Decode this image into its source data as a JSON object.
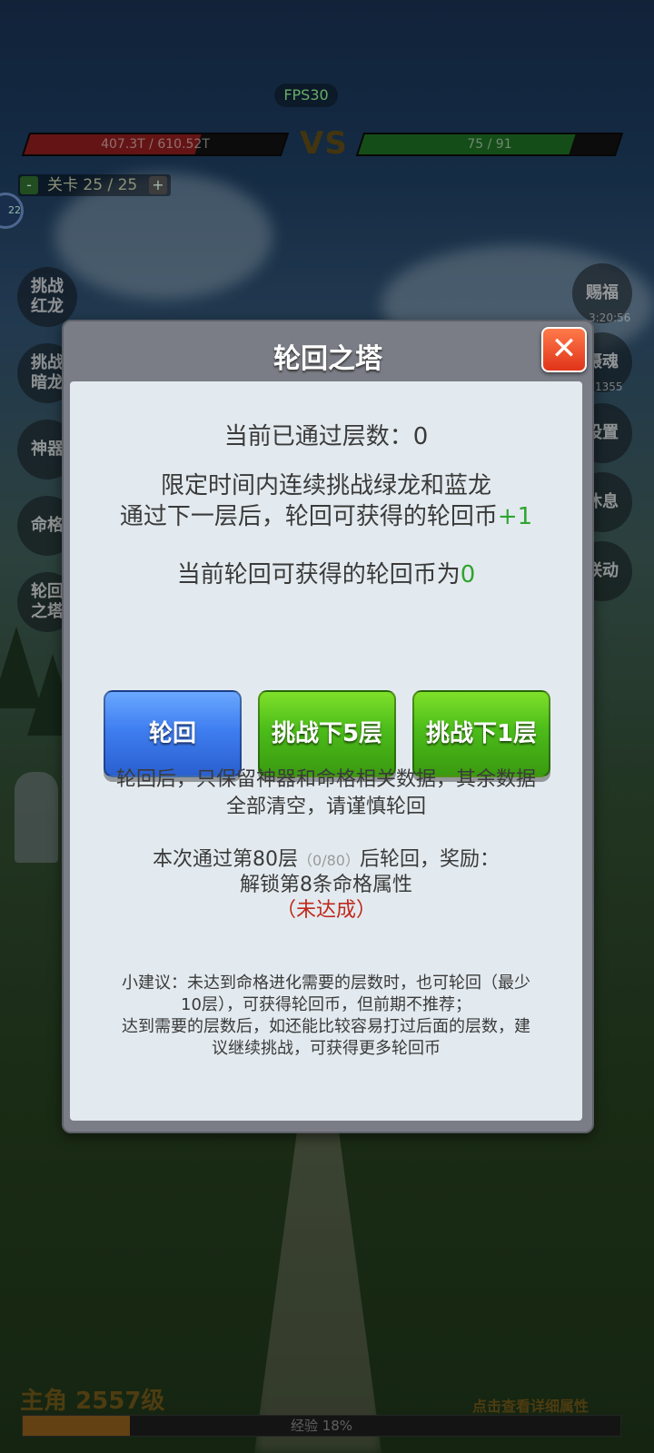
{
  "hud": {
    "fps": "FPS30",
    "player_hp": "407.3T / 610.52T",
    "player_hp_fraction": 0.667,
    "vs": "VS",
    "enemy_hp": "75 / 91",
    "enemy_hp_fraction": 0.824,
    "level_minus": "-",
    "level_text": "关卡 25 / 25",
    "level_plus": "+",
    "badge_number": "22"
  },
  "left_buttons": [
    {
      "label": "挑战\n红龙"
    },
    {
      "label": "挑战\n暗龙"
    },
    {
      "label": "神器"
    },
    {
      "label": "命格"
    },
    {
      "label": "轮回\n之塔"
    }
  ],
  "right_buttons": [
    {
      "label": "赐福",
      "note": "3:20:56"
    },
    {
      "label": "摄魂",
      "note": "1355"
    },
    {
      "label": "设置"
    },
    {
      "label": "休息"
    },
    {
      "label": "联动"
    }
  ],
  "bottom": {
    "hero_label": "主角 2557级",
    "detail_link": "点击查看详细属性",
    "exp_label": "经验 18%",
    "exp_fraction": 0.18
  },
  "dialog": {
    "title": "轮回之塔",
    "close_icon": "close-icon",
    "floors_passed": "当前已通过层数：0",
    "rule_line1": "限定时间内连续挑战绿龙和蓝龙",
    "rule_line2": "通过下一层后，轮回可获得的轮回币",
    "rule_bonus": "+1",
    "coins_prefix": "当前轮回可获得的轮回币为",
    "coins_value": "0",
    "buttons": {
      "reincarnate": "轮回",
      "challenge_5": "挑战下5层",
      "challenge_1": "挑战下1层"
    },
    "warning_line1": "轮回后，只保留神器和命格相关数据，其余数据",
    "warning_line2": "全部清空，请谨慎轮回",
    "reward_prefix": "本次通过第80层",
    "reward_progress": "（0/80）",
    "reward_suffix": "后轮回，奖励：",
    "reward_line2": "解锁第8条命格属性",
    "reward_status": "（未达成）",
    "tip_line1": "小建议：未达到命格进化需要的层数时，也可轮回（最少",
    "tip_line2": "10层），可获得轮回币，但前期不推荐；",
    "tip_line3": "达到需要的层数后，如还能比较容易打过后面的层数，建",
    "tip_line4": "议继续挑战，可获得更多轮回币"
  },
  "colors": {
    "accent_green": "#2fa42f",
    "warning_red": "#c0281a",
    "button_blue": "#3f7ef0",
    "button_green": "#4cbc1a",
    "close_orange": "#e0341a"
  }
}
